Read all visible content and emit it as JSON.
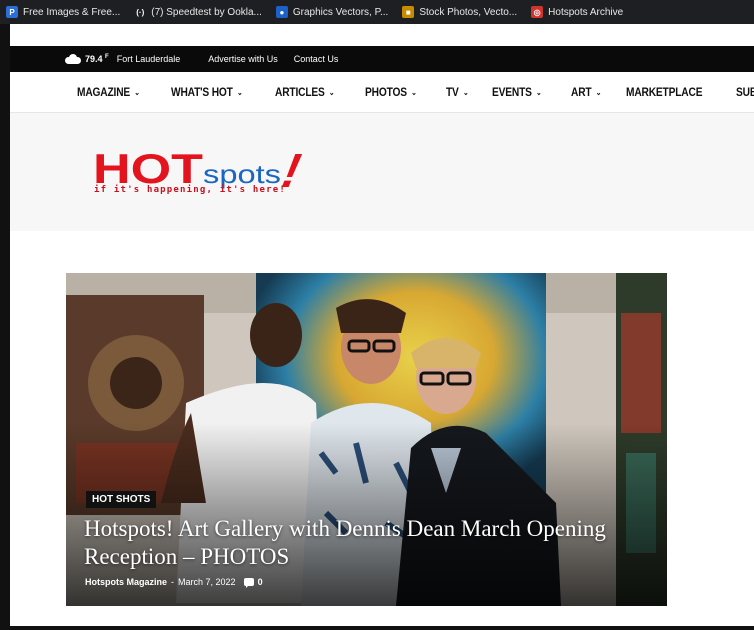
{
  "bookmarks": [
    {
      "label": "Free Images & Free...",
      "icon": "pixabay-icon",
      "color": "#2b6fd6",
      "glyph": "P"
    },
    {
      "label": "(7) Speedtest by Ookla...",
      "icon": "speedtest-icon",
      "color": "#1e1f22",
      "glyph": "(·)"
    },
    {
      "label": "Graphics Vectors, P...",
      "icon": "freepik-icon",
      "color": "#1c60c9",
      "glyph": "●"
    },
    {
      "label": "Stock Photos, Vecto...",
      "icon": "shutterstock-icon",
      "color": "#c78a00",
      "glyph": "■"
    },
    {
      "label": "Hotspots Archive",
      "icon": "hotspots-icon",
      "color": "#d0342c",
      "glyph": "◎"
    }
  ],
  "topbar": {
    "temperature": "79.4",
    "temp_unit": "F",
    "city": "Fort Lauderdale",
    "links": [
      "Advertise with Us",
      "Contact Us"
    ]
  },
  "nav": [
    {
      "label": "MAGAZINE",
      "dropdown": true
    },
    {
      "label": "WHAT'S HOT",
      "dropdown": true
    },
    {
      "label": "ARTICLES",
      "dropdown": true
    },
    {
      "label": "PHOTOS",
      "dropdown": true
    },
    {
      "label": "TV",
      "dropdown": true
    },
    {
      "label": "EVENTS",
      "dropdown": true
    },
    {
      "label": "ART",
      "dropdown": true
    },
    {
      "label": "MARKETPLACE",
      "dropdown": false
    },
    {
      "label": "SUBSCRIBE",
      "dropdown": false
    }
  ],
  "logo": {
    "text_hot": "HOT",
    "text_spots": "spots",
    "text_bang": "!",
    "tagline": "if it's happening, it's here!",
    "colors": {
      "red": "#e4141f",
      "blue": "#1a66c2"
    }
  },
  "hero": {
    "category": "HOT SHOTS",
    "headline": "Hotspots! Art Gallery with Dennis Dean March Opening Reception – PHOTOS",
    "author": "Hotspots Magazine",
    "separator": "-",
    "date": "March 7, 2022",
    "comments": "0"
  }
}
